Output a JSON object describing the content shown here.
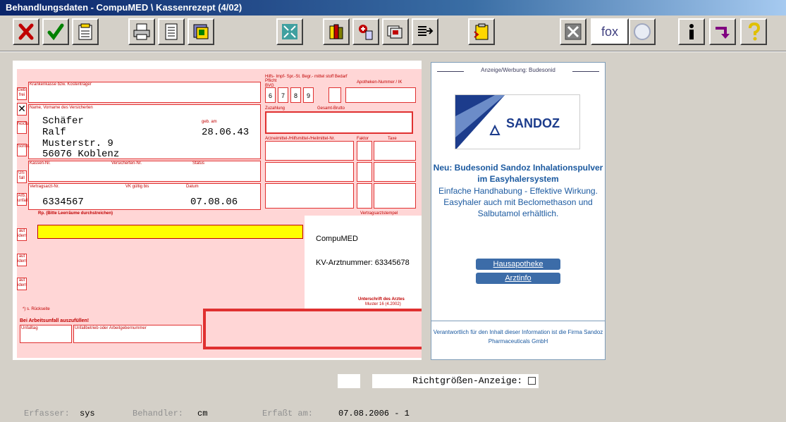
{
  "window": {
    "title": "Behandlungsdaten - CompuMED \\ Kassenrezept (4/02)"
  },
  "toolbar": {
    "buttons": [
      {
        "name": "cancel-icon"
      },
      {
        "name": "confirm-icon"
      },
      {
        "name": "document-icon"
      },
      {
        "name": "printer-icon"
      },
      {
        "name": "page-icon"
      },
      {
        "name": "forms-icon"
      },
      {
        "name": "fullscreen-icon"
      },
      {
        "name": "books-icon"
      },
      {
        "name": "medication-icon"
      },
      {
        "name": "cards-icon"
      },
      {
        "name": "export-icon"
      },
      {
        "name": "clipboard-icon"
      },
      {
        "name": "close-x-icon"
      },
      {
        "name": "magnifier-icon"
      },
      {
        "name": "info-icon"
      },
      {
        "name": "arrow-down-icon"
      },
      {
        "name": "help-icon"
      }
    ],
    "fox_label": "fox"
  },
  "rezept": {
    "krankenkasse_label": "Krankenkasse bzw. Kostenträger",
    "name_label": "Name, Vorname des Versicherten",
    "geb_label": "geb. am",
    "name_line1": "Schäfer",
    "name_line2": "Ralf",
    "street": "Musterstr. 9",
    "city": "56076 Koblenz",
    "birthdate": "28.06.43",
    "kassen_nr_label": "Kassen-Nr.",
    "versicherten_nr_label": "Versicherten-Nr.",
    "status_label": "Status",
    "vertragsarzt_label": "Vertragsarzt-Nr.",
    "vk_label": "VK gültig bis",
    "datum_label": "Datum",
    "vertragsarzt_nr": "6334567",
    "datum": "07.08.06",
    "rp_label": "Rp. (Bitte Leerräume durchstreichen)",
    "stempel_label": "Vertragsarztstempel",
    "aut_idem": [
      "aut idem",
      "aut idem",
      "aut idem"
    ],
    "side_gebfrei": "Geb. frei",
    "side_noctu": "Noctu",
    "side_sonst": "Sonst.",
    "side_unfall": "Un- fall",
    "side_arbunfall": "Arb. unfall",
    "bvg_header": "BVG",
    "bvg_digits": [
      "6",
      "7",
      "8",
      "9"
    ],
    "hilfsmittel_header": "Hilfs- Impf- Spr.-St. Begr.- mittel stoff Bedarf Pflicht",
    "apotheke_label": "Apotheken-Nummer / IK",
    "zuzahlung_label": "Zuzahlung",
    "gesamt_label": "Gesamt-Brutto",
    "arzneimittel_label": "Arzneimittel-/Hilfsmittel-/Heilmittel-Nr.",
    "faktor_label": "Faktor",
    "taxe_label": "Taxe",
    "stamp_name": "CompuMED",
    "kv_nummer": "KV-Arztnummer: 63345678",
    "unterschrift_label": "Unterschrift des Arztes",
    "muster_label": "Muster 16 (4.2002)",
    "footnote": "*) s. Rückseite",
    "arbeitsunfall_label": "Bei Arbeitsunfall auszufüllen!",
    "unfalltag_label": "Unfalltag",
    "unfallbetrieb_label": "Unfallbetrieb oder Arbeitgebernummer"
  },
  "ad": {
    "heading": "Anzeige/Werbung: Budesonid",
    "logo_text": "SANDOZ",
    "title": "Neu: Budesonid Sandoz Inhalationspulver im Easyhalersystem",
    "body": "Einfache Handhabung - Effektive Wirkung. Easyhaler auch mit Beclomethason und Salbutamol erhältlich.",
    "link1": "Hausapotheke",
    "link2": "Arztinfo",
    "footer": "Verantwortlich für den Inhalt dieser Information ist die Firma Sandoz Pharmaceuticals GmbH",
    "colors": {
      "brand": "#1c5aa0",
      "button": "#3c6ca8"
    }
  },
  "bottom": {
    "richtgroessen_label": "Richtgrößen-Anzeige:",
    "erfasser_label": "Erfasser:",
    "erfasser_value": "sys",
    "behandler_label": "Behandler:",
    "behandler_value": "cm",
    "erfasst_label": "Erfaßt am:",
    "erfasst_value": "07.08.2006 - 1"
  }
}
